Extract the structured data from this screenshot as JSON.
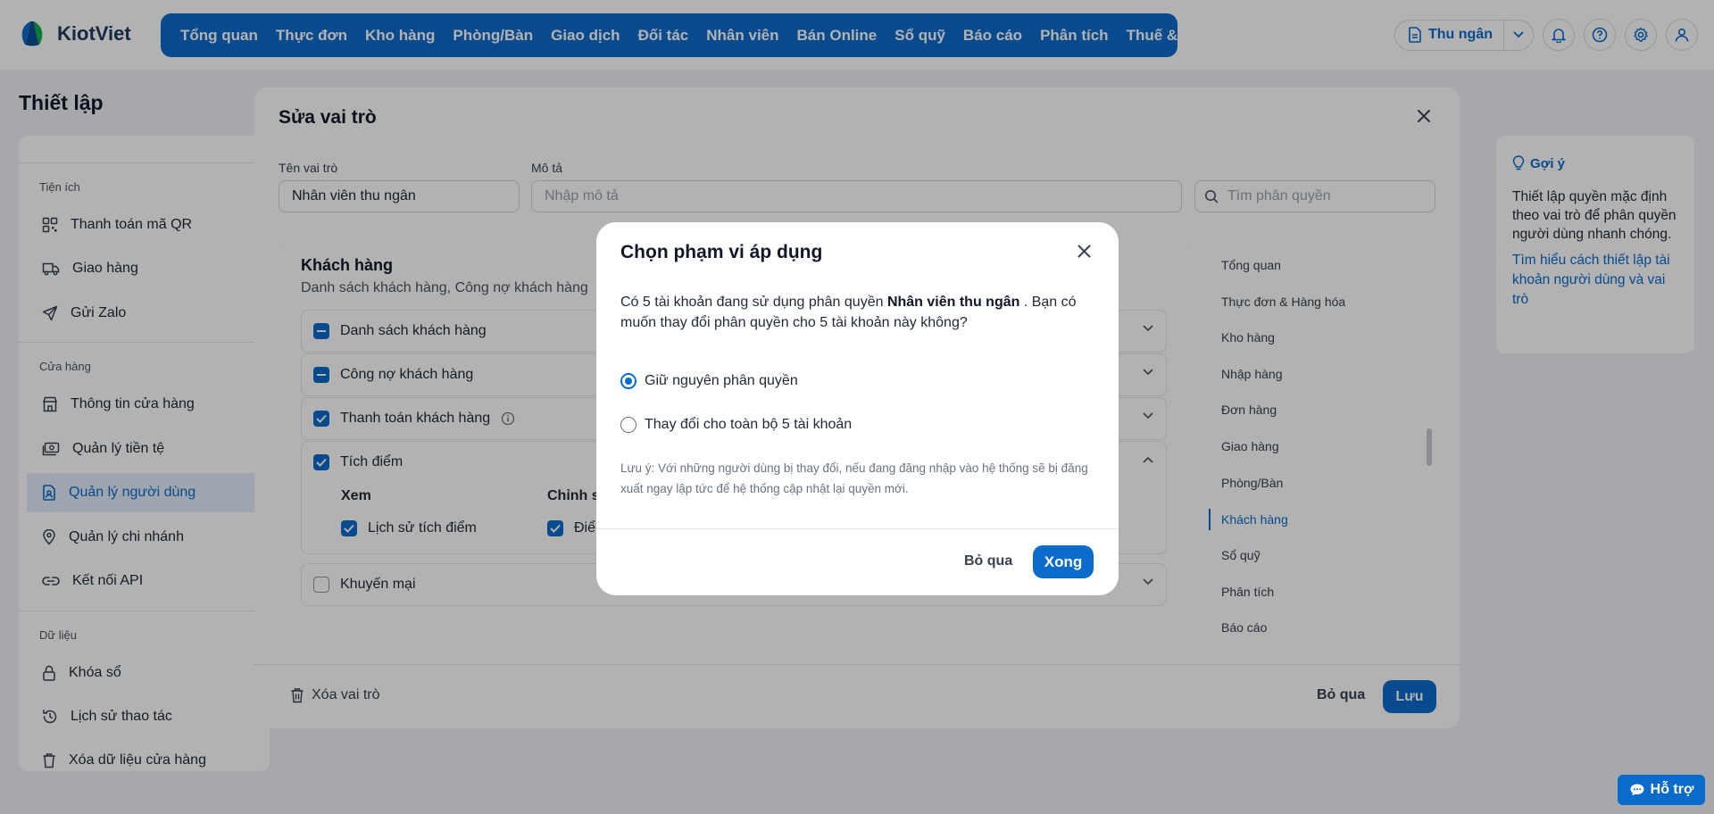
{
  "brand": {
    "name": "KiotViet"
  },
  "nav": [
    "Tổng quan",
    "Thực đơn",
    "Kho hàng",
    "Phòng/Bàn",
    "Giao dịch",
    "Đối tác",
    "Nhân viên",
    "Bán Online",
    "Sổ quỹ",
    "Báo cáo",
    "Phân tích",
    "Thuế & Kế toán"
  ],
  "topright": {
    "cashier_label": "Thu ngân"
  },
  "page": {
    "title": "Thiết lập"
  },
  "sidebar": {
    "groups": [
      "Tiện ích",
      "Cửa hàng",
      "Dữ liệu"
    ],
    "items": [
      {
        "label": "Thanh toán mã QR",
        "icon": "qr-icon"
      },
      {
        "label": "Giao hàng",
        "icon": "truck-icon"
      },
      {
        "label": "Gửi Zalo",
        "icon": "send-icon"
      },
      {
        "label": "Thông tin cửa hàng",
        "icon": "store-icon"
      },
      {
        "label": "Quản lý tiền tệ",
        "icon": "money-icon"
      },
      {
        "label": "Quản lý người dùng",
        "icon": "user-file-icon"
      },
      {
        "label": "Quản lý chi nhánh",
        "icon": "location-icon"
      },
      {
        "label": "Kết nối API",
        "icon": "link-icon"
      },
      {
        "label": "Khóa sổ",
        "icon": "lock-icon"
      },
      {
        "label": "Lịch sử thao tác",
        "icon": "history-icon"
      },
      {
        "label": "Xóa dữ liệu cửa hàng",
        "icon": "trash-icon"
      }
    ],
    "active": "Quản lý người dùng"
  },
  "tip": {
    "title": "Gợi ý",
    "body": "Thiết lập quyền mặc định theo vai trò để phân quyền người dùng nhanh chóng.",
    "link": "Tìm hiểu cách thiết lập tài khoản người dùng và vai trò"
  },
  "edit_role": {
    "title": "Sửa vai trò",
    "role_name_label": "Tên vai trò",
    "role_name_value": "Nhân viên thu ngân",
    "desc_label": "Mô tả",
    "desc_placeholder": "Nhập mô tả",
    "search_placeholder": "Tìm phân quyền",
    "section_title": "Khách hàng",
    "section_sub": "Danh sách khách hàng, Công nợ khách hàng",
    "rows": [
      {
        "label": "Danh sách khách hàng",
        "state": "partial"
      },
      {
        "label": "Công nợ khách hàng",
        "state": "partial"
      },
      {
        "label": "Thanh toán khách hàng",
        "state": "checked"
      },
      {
        "label": "Tích điểm",
        "state": "checked"
      },
      {
        "label": "Khuyến mại",
        "state": "unchecked"
      }
    ],
    "points_sub": {
      "view_heading": "Xem",
      "edit_heading": "Chỉnh s",
      "view_item": "Lịch sử tích điểm",
      "edit_item": "Điể"
    },
    "right_nav": [
      "Tổng quan",
      "Thực đơn & Hàng hóa",
      "Kho hàng",
      "Nhập hàng",
      "Đơn hàng",
      "Giao hàng",
      "Phòng/Bàn",
      "Khách hàng",
      "Sổ quỹ",
      "Phân tích",
      "Báo cáo"
    ],
    "right_nav_active": "Khách hàng",
    "delete_label": "Xóa vai trò",
    "skip_label": "Bỏ qua",
    "save_label": "Lưu"
  },
  "dialog": {
    "title": "Chọn phạm vi áp dụng",
    "msg_pre": "Có 5 tài khoản đang sử dụng phân quyền ",
    "msg_bold": "Nhân viên thu ngân",
    "msg_post": " . Bạn có muốn thay đổi phân quyền cho 5 tài khoản này không?",
    "option_keep": "Giữ nguyên phân quyền",
    "option_change": "Thay đổi cho toàn bộ 5 tài khoản",
    "selected": "keep",
    "note": "Lưu ý: Với những người dùng bị thay đổi, nếu đang đăng nhập vào hệ thống sẽ bị đăng xuất ngay lập tức để hệ thống cập nhật lại quyền mới.",
    "skip_label": "Bỏ qua",
    "done_label": "Xong"
  },
  "help": {
    "label": "Hỗ trợ"
  },
  "colors": {
    "accent": "#0b6bcb"
  }
}
